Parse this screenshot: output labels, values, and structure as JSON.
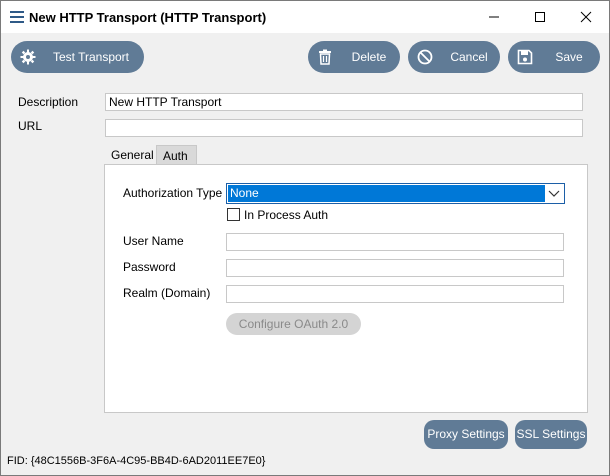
{
  "window": {
    "title": "New HTTP Transport (HTTP Transport)",
    "controls": {
      "minimize": "—",
      "maximize": "☐",
      "close": "✕"
    }
  },
  "toolbar": {
    "test_transport": "Test Transport",
    "delete": "Delete",
    "cancel": "Cancel",
    "save": "Save",
    "button_color": "#607b96"
  },
  "form": {
    "description_label": "Description",
    "description_value": "New HTTP Transport",
    "url_label": "URL",
    "url_value": ""
  },
  "tabs": [
    {
      "label": "General",
      "selected": false
    },
    {
      "label": "Auth",
      "selected": true
    }
  ],
  "auth": {
    "authorization_type_label": "Authorization Type",
    "authorization_type_value": "None",
    "in_process_auth_label": "In Process Auth",
    "in_process_auth_checked": false,
    "user_name_label": "User Name",
    "user_name_value": "",
    "password_label": "Password",
    "password_value": "",
    "realm_label": "Realm (Domain)",
    "realm_value": "",
    "configure_oauth_label": "Configure OAuth 2.0"
  },
  "footer_buttons": {
    "proxy_settings": "Proxy Settings",
    "ssl_settings": "SSL Settings"
  },
  "status": {
    "fid": "FID: {48C1556B-3F6A-4C95-BB4D-6AD2011EE7E0}"
  }
}
